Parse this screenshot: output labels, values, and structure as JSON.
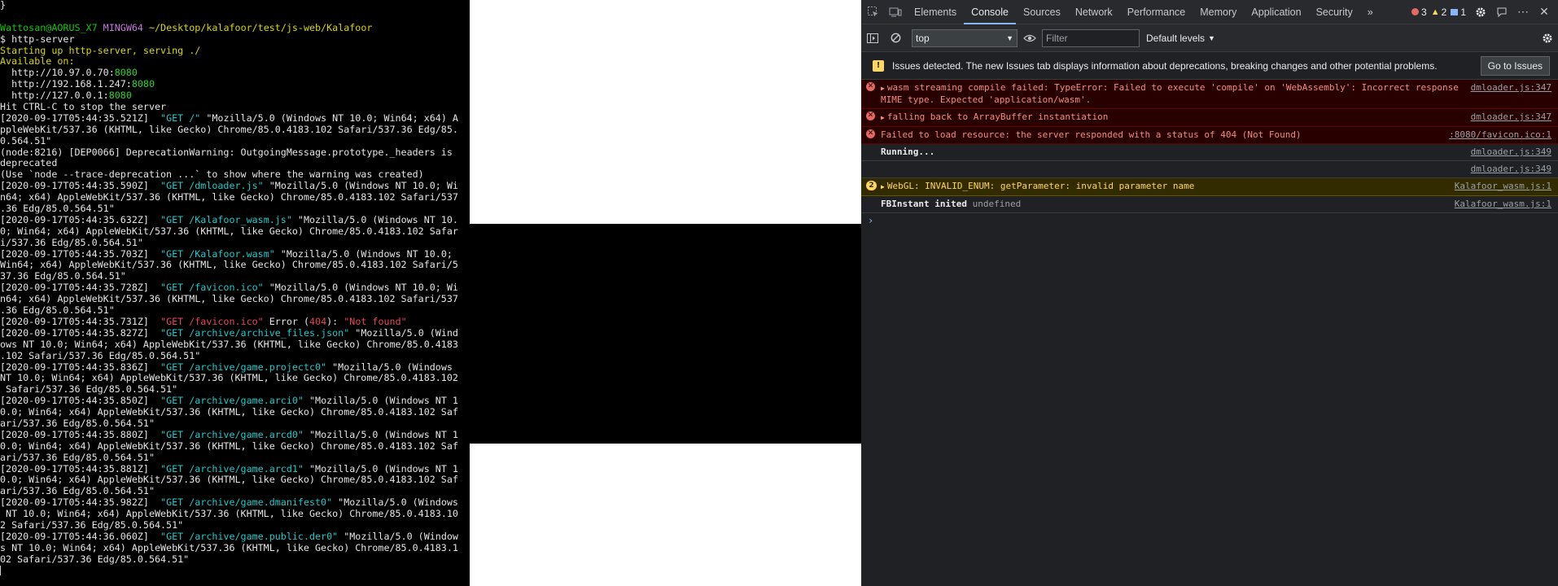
{
  "terminal": {
    "lines": [
      {
        "segments": [
          {
            "text": "}",
            "c": "t-white"
          }
        ]
      },
      {
        "segments": []
      },
      {
        "segments": [
          {
            "text": "Wattosan@AORUS_X7",
            "c": "t-green"
          },
          {
            "text": " ",
            "c": "t-white"
          },
          {
            "text": "MINGW64",
            "c": "t-purple"
          },
          {
            "text": " ",
            "c": "t-white"
          },
          {
            "text": "~/Desktop/kalafoor/test/js-web/Kalafoor",
            "c": "t-yellow"
          }
        ]
      },
      {
        "segments": [
          {
            "text": "$ http-server",
            "c": "t-white"
          }
        ]
      },
      {
        "segments": [
          {
            "text": "Starting up http-server, serving ./",
            "c": "t-yellow"
          }
        ]
      },
      {
        "segments": [
          {
            "text": "Available on:",
            "c": "t-yellow"
          }
        ]
      },
      {
        "segments": [
          {
            "text": "  http://10.97.0.70:",
            "c": "t-white"
          },
          {
            "text": "8080",
            "c": "t-bgreen"
          }
        ]
      },
      {
        "segments": [
          {
            "text": "  http://192.168.1.247:",
            "c": "t-white"
          },
          {
            "text": "8080",
            "c": "t-bgreen"
          }
        ]
      },
      {
        "segments": [
          {
            "text": "  http://127.0.0.1:",
            "c": "t-white"
          },
          {
            "text": "8080",
            "c": "t-bgreen"
          }
        ]
      },
      {
        "segments": [
          {
            "text": "Hit CTRL-C to stop the server",
            "c": "t-white"
          }
        ]
      },
      {
        "segments": [
          {
            "text": "[2020-09-17T05:44:35.521Z]  ",
            "c": "t-white"
          },
          {
            "text": "\"GET /\"",
            "c": "t-cyan"
          },
          {
            "text": " \"Mozilla/5.0 (Windows NT 10.0; Win64; x64) A",
            "c": "t-white"
          }
        ]
      },
      {
        "segments": [
          {
            "text": "ppleWebKit/537.36 (KHTML, like Gecko) Chrome/85.0.4183.102 Safari/537.36 Edg/85.",
            "c": "t-white"
          }
        ]
      },
      {
        "segments": [
          {
            "text": "0.564.51\"",
            "c": "t-white"
          }
        ]
      },
      {
        "segments": [
          {
            "text": "(node:8216) [DEP0066] DeprecationWarning: OutgoingMessage.prototype._headers is",
            "c": "t-white"
          }
        ]
      },
      {
        "segments": [
          {
            "text": "deprecated",
            "c": "t-white"
          }
        ]
      },
      {
        "segments": [
          {
            "text": "(Use `node --trace-deprecation ...` to show where the warning was created)",
            "c": "t-white"
          }
        ]
      },
      {
        "segments": [
          {
            "text": "[2020-09-17T05:44:35.590Z]  ",
            "c": "t-white"
          },
          {
            "text": "\"GET /dmloader.js\"",
            "c": "t-cyan"
          },
          {
            "text": " \"Mozilla/5.0 (Windows NT 10.0; Wi",
            "c": "t-white"
          }
        ]
      },
      {
        "segments": [
          {
            "text": "n64; x64) AppleWebKit/537.36 (KHTML, like Gecko) Chrome/85.0.4183.102 Safari/537",
            "c": "t-white"
          }
        ]
      },
      {
        "segments": [
          {
            "text": ".36 Edg/85.0.564.51\"",
            "c": "t-white"
          }
        ]
      },
      {
        "segments": [
          {
            "text": "[2020-09-17T05:44:35.632Z]  ",
            "c": "t-white"
          },
          {
            "text": "\"GET /Kalafoor_wasm.js\"",
            "c": "t-cyan"
          },
          {
            "text": " \"Mozilla/5.0 (Windows NT 10.",
            "c": "t-white"
          }
        ]
      },
      {
        "segments": [
          {
            "text": "0; Win64; x64) AppleWebKit/537.36 (KHTML, like Gecko) Chrome/85.0.4183.102 Safar",
            "c": "t-white"
          }
        ]
      },
      {
        "segments": [
          {
            "text": "i/537.36 Edg/85.0.564.51\"",
            "c": "t-white"
          }
        ]
      },
      {
        "segments": [
          {
            "text": "[2020-09-17T05:44:35.703Z]  ",
            "c": "t-white"
          },
          {
            "text": "\"GET /Kalafoor.wasm\"",
            "c": "t-cyan"
          },
          {
            "text": " \"Mozilla/5.0 (Windows NT 10.0;",
            "c": "t-white"
          }
        ]
      },
      {
        "segments": [
          {
            "text": "Win64; x64) AppleWebKit/537.36 (KHTML, like Gecko) Chrome/85.0.4183.102 Safari/5",
            "c": "t-white"
          }
        ]
      },
      {
        "segments": [
          {
            "text": "37.36 Edg/85.0.564.51\"",
            "c": "t-white"
          }
        ]
      },
      {
        "segments": [
          {
            "text": "[2020-09-17T05:44:35.728Z]  ",
            "c": "t-white"
          },
          {
            "text": "\"GET /favicon.ico\"",
            "c": "t-cyan"
          },
          {
            "text": " \"Mozilla/5.0 (Windows NT 10.0; Wi",
            "c": "t-white"
          }
        ]
      },
      {
        "segments": [
          {
            "text": "n64; x64) AppleWebKit/537.36 (KHTML, like Gecko) Chrome/85.0.4183.102 Safari/537",
            "c": "t-white"
          }
        ]
      },
      {
        "segments": [
          {
            "text": ".36 Edg/85.0.564.51\"",
            "c": "t-white"
          }
        ]
      },
      {
        "segments": [
          {
            "text": "[2020-09-17T05:44:35.731Z]  ",
            "c": "t-white"
          },
          {
            "text": "\"GET /favicon.ico\"",
            "c": "t-red"
          },
          {
            "text": " Error (",
            "c": "t-white"
          },
          {
            "text": "404",
            "c": "t-red"
          },
          {
            "text": "): ",
            "c": "t-white"
          },
          {
            "text": "\"Not found\"",
            "c": "t-red"
          }
        ]
      },
      {
        "segments": [
          {
            "text": "[2020-09-17T05:44:35.827Z]  ",
            "c": "t-white"
          },
          {
            "text": "\"GET /archive/archive_files.json\"",
            "c": "t-cyan"
          },
          {
            "text": " \"Mozilla/5.0 (Wind",
            "c": "t-white"
          }
        ]
      },
      {
        "segments": [
          {
            "text": "ows NT 10.0; Win64; x64) AppleWebKit/537.36 (KHTML, like Gecko) Chrome/85.0.4183",
            "c": "t-white"
          }
        ]
      },
      {
        "segments": [
          {
            "text": ".102 Safari/537.36 Edg/85.0.564.51\"",
            "c": "t-white"
          }
        ]
      },
      {
        "segments": [
          {
            "text": "[2020-09-17T05:44:35.836Z]  ",
            "c": "t-white"
          },
          {
            "text": "\"GET /archive/game.projectc0\"",
            "c": "t-cyan"
          },
          {
            "text": " \"Mozilla/5.0 (Windows",
            "c": "t-white"
          }
        ]
      },
      {
        "segments": [
          {
            "text": "NT 10.0; Win64; x64) AppleWebKit/537.36 (KHTML, like Gecko) Chrome/85.0.4183.102",
            "c": "t-white"
          }
        ]
      },
      {
        "segments": [
          {
            "text": " Safari/537.36 Edg/85.0.564.51\"",
            "c": "t-white"
          }
        ]
      },
      {
        "segments": [
          {
            "text": "[2020-09-17T05:44:35.850Z]  ",
            "c": "t-white"
          },
          {
            "text": "\"GET /archive/game.arci0\"",
            "c": "t-cyan"
          },
          {
            "text": " \"Mozilla/5.0 (Windows NT 1",
            "c": "t-white"
          }
        ]
      },
      {
        "segments": [
          {
            "text": "0.0; Win64; x64) AppleWebKit/537.36 (KHTML, like Gecko) Chrome/85.0.4183.102 Saf",
            "c": "t-white"
          }
        ]
      },
      {
        "segments": [
          {
            "text": "ari/537.36 Edg/85.0.564.51\"",
            "c": "t-white"
          }
        ]
      },
      {
        "segments": [
          {
            "text": "[2020-09-17T05:44:35.880Z]  ",
            "c": "t-white"
          },
          {
            "text": "\"GET /archive/game.arcd0\"",
            "c": "t-cyan"
          },
          {
            "text": " \"Mozilla/5.0 (Windows NT 1",
            "c": "t-white"
          }
        ]
      },
      {
        "segments": [
          {
            "text": "0.0; Win64; x64) AppleWebKit/537.36 (KHTML, like Gecko) Chrome/85.0.4183.102 Saf",
            "c": "t-white"
          }
        ]
      },
      {
        "segments": [
          {
            "text": "ari/537.36 Edg/85.0.564.51\"",
            "c": "t-white"
          }
        ]
      },
      {
        "segments": [
          {
            "text": "[2020-09-17T05:44:35.881Z]  ",
            "c": "t-white"
          },
          {
            "text": "\"GET /archive/game.arcd1\"",
            "c": "t-cyan"
          },
          {
            "text": " \"Mozilla/5.0 (Windows NT 1",
            "c": "t-white"
          }
        ]
      },
      {
        "segments": [
          {
            "text": "0.0; Win64; x64) AppleWebKit/537.36 (KHTML, like Gecko) Chrome/85.0.4183.102 Saf",
            "c": "t-white"
          }
        ]
      },
      {
        "segments": [
          {
            "text": "ari/537.36 Edg/85.0.564.51\"",
            "c": "t-white"
          }
        ]
      },
      {
        "segments": [
          {
            "text": "[2020-09-17T05:44:35.982Z]  ",
            "c": "t-white"
          },
          {
            "text": "\"GET /archive/game.dmanifest0\"",
            "c": "t-cyan"
          },
          {
            "text": " \"Mozilla/5.0 (Windows",
            "c": "t-white"
          }
        ]
      },
      {
        "segments": [
          {
            "text": " NT 10.0; Win64; x64) AppleWebKit/537.36 (KHTML, like Gecko) Chrome/85.0.4183.10",
            "c": "t-white"
          }
        ]
      },
      {
        "segments": [
          {
            "text": "2 Safari/537.36 Edg/85.0.564.51\"",
            "c": "t-white"
          }
        ]
      },
      {
        "segments": [
          {
            "text": "[2020-09-17T05:44:36.060Z]  ",
            "c": "t-white"
          },
          {
            "text": "\"GET /archive/game.public.der0\"",
            "c": "t-cyan"
          },
          {
            "text": " \"Mozilla/5.0 (Window",
            "c": "t-white"
          }
        ]
      },
      {
        "segments": [
          {
            "text": "s NT 10.0; Win64; x64) AppleWebKit/537.36 (KHTML, like Gecko) Chrome/85.0.4183.1",
            "c": "t-white"
          }
        ]
      },
      {
        "segments": [
          {
            "text": "02 Safari/537.36 Edg/85.0.564.51\"",
            "c": "t-white"
          }
        ]
      }
    ]
  },
  "devtools": {
    "tabs": [
      {
        "label": "Elements",
        "name": "tab-elements",
        "active": false
      },
      {
        "label": "Console",
        "name": "tab-console",
        "active": true
      },
      {
        "label": "Sources",
        "name": "tab-sources",
        "active": false
      },
      {
        "label": "Network",
        "name": "tab-network",
        "active": false
      },
      {
        "label": "Performance",
        "name": "tab-performance",
        "active": false
      },
      {
        "label": "Memory",
        "name": "tab-memory",
        "active": false
      },
      {
        "label": "Application",
        "name": "tab-application",
        "active": false
      },
      {
        "label": "Security",
        "name": "tab-security",
        "active": false
      }
    ],
    "more_tabs_glyph": "»",
    "badges": {
      "errors": "3",
      "warnings": "2",
      "info": "1"
    },
    "colors": {
      "error": "#e46962",
      "warning": "#fdd663",
      "info": "#8ab4f8"
    },
    "toolbar": {
      "context": "top",
      "filter_placeholder": "Filter",
      "levels": "Default levels"
    },
    "issues": {
      "text": "Issues detected. The new Issues tab displays information about deprecations, breaking changes and other potential problems.",
      "button": "Go to Issues"
    },
    "messages": [
      {
        "kind": "error",
        "expandable": true,
        "text": "wasm streaming compile failed: TypeError: Failed to execute 'compile' on 'WebAssembly': Incorrect response MIME type. Expected 'application/wasm'.",
        "source": "dmloader.js:347"
      },
      {
        "kind": "error",
        "expandable": true,
        "text": "falling back to ArrayBuffer instantiation",
        "source": "dmloader.js:347"
      },
      {
        "kind": "error",
        "expandable": false,
        "text": "Failed to load resource: the server responded with a status of 404 (Not Found)",
        "source": ":8080/favicon.ico:1"
      },
      {
        "kind": "plain",
        "expandable": false,
        "text": "Running...",
        "source": "dmloader.js:349"
      },
      {
        "kind": "plain",
        "expandable": false,
        "text": "",
        "source": "dmloader.js:349"
      },
      {
        "kind": "warning",
        "expandable": true,
        "count": "2",
        "text": "WebGL: INVALID_ENUM: getParameter: invalid parameter name",
        "source": "Kalafoor_wasm.js:1"
      },
      {
        "kind": "plain",
        "expandable": false,
        "text": "FBInstant inited",
        "extra": "undefined",
        "source": "Kalafoor_wasm.js:1"
      }
    ]
  }
}
